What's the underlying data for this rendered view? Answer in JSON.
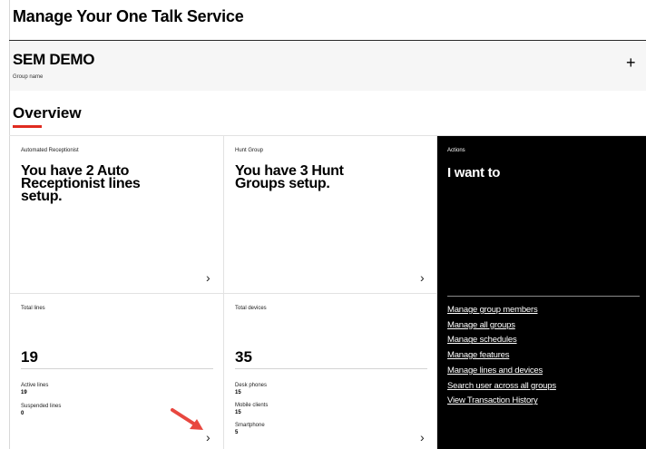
{
  "page": {
    "title": "Manage Your One Talk Service"
  },
  "group": {
    "name": "SEM DEMO",
    "caption": "Group name",
    "expand_label": "+"
  },
  "overview": {
    "heading": "Overview"
  },
  "cards": {
    "auto_receptionist": {
      "label": "Automated Receptionist",
      "headline": "You have 2 Auto Receptionist lines setup.",
      "chevron": "›"
    },
    "hunt_group": {
      "label": "Hunt Group",
      "headline": "You have 3 Hunt Groups setup.",
      "chevron": "›"
    },
    "total_lines": {
      "label": "Total lines",
      "value": "19",
      "stats": [
        {
          "label": "Active lines",
          "value": "19"
        },
        {
          "label": "Suspended lines",
          "value": "0"
        }
      ],
      "chevron": "›"
    },
    "total_devices": {
      "label": "Total devices",
      "value": "35",
      "stats": [
        {
          "label": "Desk phones",
          "value": "15"
        },
        {
          "label": "Mobile clients",
          "value": "15"
        },
        {
          "label": "Smartphone",
          "value": "5"
        }
      ],
      "chevron": "›"
    }
  },
  "actions": {
    "label": "Actions",
    "title": "I want to",
    "links": [
      "Manage group members",
      "Manage all groups",
      "Manage schedules",
      "Manage features",
      "Manage lines and devices",
      "Search user across all groups",
      "View Transaction History"
    ]
  },
  "colors": {
    "accent_red": "#e02b20",
    "annotation_arrow": "#e8473f",
    "actions_bg": "#000000"
  }
}
